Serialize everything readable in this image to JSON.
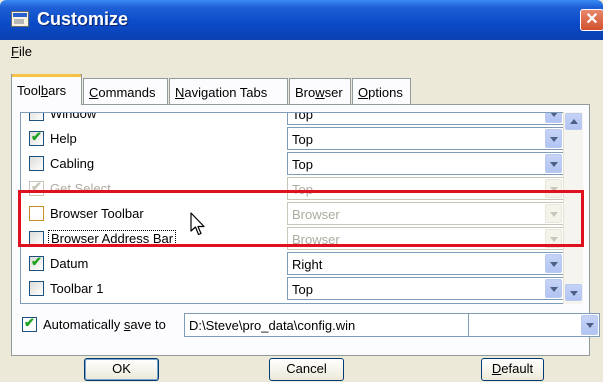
{
  "window": {
    "title": "Customize",
    "close_glyph": "✕"
  },
  "menu": {
    "file_prefix": "F",
    "file_rest": "ile"
  },
  "tabs": [
    {
      "pre": "Tool",
      "ul": "b",
      "post": "ars"
    },
    {
      "pre": "",
      "ul": "C",
      "post": "ommands"
    },
    {
      "pre": "",
      "ul": "N",
      "post": "avigation Tabs"
    },
    {
      "pre": "Bro",
      "ul": "w",
      "post": "ser"
    },
    {
      "pre": "",
      "ul": "O",
      "post": "ptions"
    }
  ],
  "toolbar_rows": [
    {
      "label": "Window",
      "value": "Top",
      "checked": false,
      "disabled": false
    },
    {
      "label": "Help",
      "value": "Top",
      "checked": true,
      "disabled": false
    },
    {
      "label": "Cabling",
      "value": "Top",
      "checked": false,
      "disabled": false
    },
    {
      "label": "Get Select",
      "value": "Top",
      "checked": true,
      "disabled": true
    },
    {
      "label": "Browser Toolbar",
      "value": "Browser",
      "checked": false,
      "disabled": true
    },
    {
      "label": "Browser Address Bar",
      "value": "Browser",
      "checked": false,
      "disabled": true
    },
    {
      "label": "Datum",
      "value": "Right",
      "checked": true,
      "disabled": false
    },
    {
      "label": "Toolbar 1",
      "value": "Top",
      "checked": false,
      "disabled": false
    }
  ],
  "autosave": {
    "checked": true,
    "label_pre": "Automatically ",
    "label_ul": "s",
    "label_post": "ave to",
    "path": "D:\\Steve\\pro_data\\config.win"
  },
  "buttons": {
    "ok": "OK",
    "cancel": "Cancel",
    "default_ul": "D",
    "default_rest": "efault"
  },
  "colors": {
    "title_blue": "#0b4cc9",
    "highlight_red": "#e0111e",
    "check_green": "#21a121"
  },
  "icons": [
    "window-icon",
    "close-icon",
    "checkbox-icon",
    "dropdown-arrow-icon",
    "mouse-pointer-icon",
    "scroll-up-icon",
    "scroll-down-icon"
  ]
}
